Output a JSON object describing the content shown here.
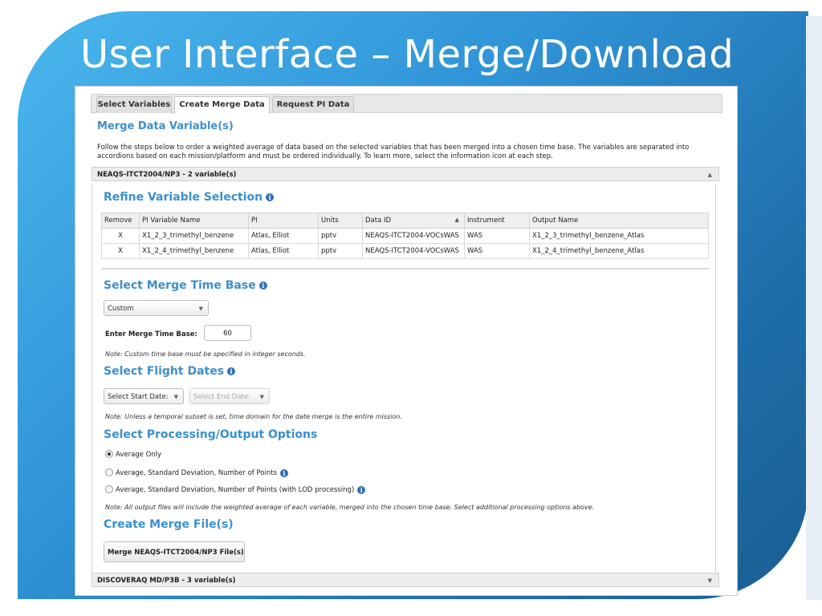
{
  "slide": {
    "title": "User Interface – Merge/Download"
  },
  "tabs": [
    {
      "label": "Select Variables"
    },
    {
      "label": "Create Merge Data"
    },
    {
      "label": "Request PI Data"
    }
  ],
  "merge": {
    "title": "Merge Data Variable(s)",
    "description": "Follow the steps below to order a weighted average of data based on the selected variables that has been merged into a chosen time base. The variables are separated into accordions based on each mission/platform and must be ordered individually. To learn more, select the information icon at each step."
  },
  "accordions": [
    {
      "label": "NEAQS-ITCT2004/NP3 - 2 variable(s)"
    },
    {
      "label": "DISCOVERAQ MD/P3B - 3 variable(s)"
    }
  ],
  "refine": {
    "title": "Refine Variable Selection",
    "columns": [
      "Remove",
      "PI Variable Name",
      "PI",
      "Units",
      "Data ID",
      "Instrument",
      "Output Name"
    ],
    "rows": [
      {
        "remove": "X",
        "variable": "X1_2_3_trimethyl_benzene",
        "pi": "Atlas, Elliot",
        "units": "pptv",
        "data_id": "NEAQS-ITCT2004-VOCsWAS",
        "instrument": "WAS",
        "output": "X1_2_3_trimethyl_benzene_Atlas"
      },
      {
        "remove": "X",
        "variable": "X1_2_4_trimethyl_benzene",
        "pi": "Atlas, Elliot",
        "units": "pptv",
        "data_id": "NEAQS-ITCT2004-VOCsWAS",
        "instrument": "WAS",
        "output": "X1_2_4_trimethyl_benzene_Atlas"
      }
    ]
  },
  "time_base": {
    "title": "Select Merge Time Base",
    "selected": "Custom",
    "enter_label": "Enter Merge Time Base:",
    "value": "60",
    "note": "Note: Custom time base must be specified in integer seconds."
  },
  "flight_dates": {
    "title": "Select Flight Dates",
    "start_label": "Select Start Date:",
    "end_label": "Select End Date:",
    "note": "Note: Unless a temporal subset is set, time domain for the date merge is the entire mission."
  },
  "processing": {
    "title": "Select Processing/Output Options",
    "options": [
      {
        "label": "Average Only",
        "checked": true
      },
      {
        "label": "Average, Standard Deviation, Number of Points",
        "checked": false
      },
      {
        "label": "Average, Standard Deviation, Number of Points (with LOD processing)",
        "checked": false
      }
    ],
    "note": "Note: All output files will include the weighted average of each variable, merged into the chosen time base. Select additional processing options above."
  },
  "create": {
    "title": "Create Merge File(s)",
    "button_label": "Merge NEAQS-ITCT2004/NP3 File(s)"
  },
  "colors": {
    "accent": "#3a8fd0",
    "slide_blue": "#2f93d6",
    "info_icon": "#2f6fb8"
  }
}
